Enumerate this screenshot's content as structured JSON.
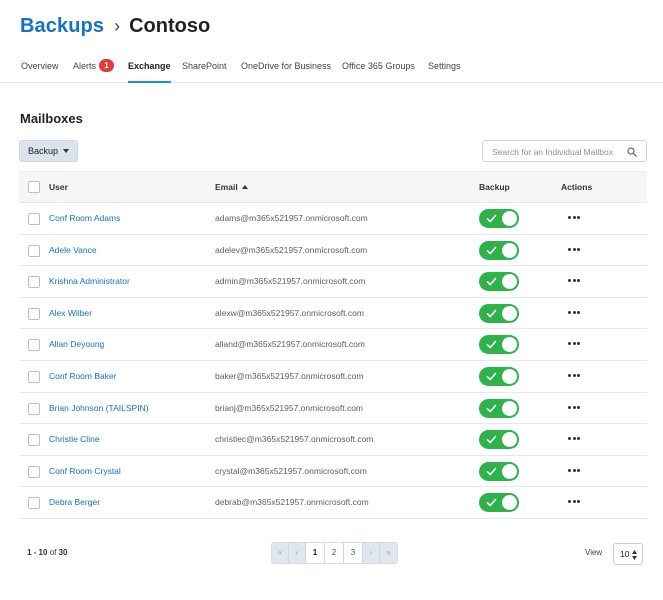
{
  "breadcrumb": {
    "root": "Backups",
    "separator": "›",
    "current": "Contoso"
  },
  "tabs": [
    {
      "label": "Overview",
      "badge": null,
      "active": false
    },
    {
      "label": "Alerts",
      "badge": "1",
      "active": false
    },
    {
      "label": "Exchange",
      "badge": null,
      "active": true
    },
    {
      "label": "SharePoint",
      "badge": null,
      "active": false
    },
    {
      "label": "OneDrive for Business",
      "badge": null,
      "active": false
    },
    {
      "label": "Office 365 Groups",
      "badge": null,
      "active": false
    },
    {
      "label": "Settings",
      "badge": null,
      "active": false
    }
  ],
  "section": {
    "title": "Mailboxes"
  },
  "toolbar": {
    "backup_label": "Backup",
    "search_placeholder": "Search for an Individual Mailbox"
  },
  "table": {
    "columns": {
      "user": "User",
      "email": "Email",
      "backup": "Backup",
      "actions": "Actions"
    },
    "rows": [
      {
        "user": "Conf Room Adams",
        "email": "adams@m365x521957.onmicrosoft.com",
        "backup": true
      },
      {
        "user": "Adele Vance",
        "email": "adelev@m365x521957.onmicrosoft.com",
        "backup": true
      },
      {
        "user": "Krishna Administrator",
        "email": "admin@m365x521957.onmicrosoft.com",
        "backup": true
      },
      {
        "user": "Alex Wilber",
        "email": "alexw@m365x521957.onmicrosoft.com",
        "backup": true
      },
      {
        "user": "Allan Deyoung",
        "email": "alland@m365x521957.onmicrosoft.com",
        "backup": true
      },
      {
        "user": "Conf Room Baker",
        "email": "baker@m365x521957.onmicrosoft.com",
        "backup": true
      },
      {
        "user": "Brian Johnson (TAILSPIN)",
        "email": "brianj@m365x521957.onmicrosoft.com",
        "backup": true
      },
      {
        "user": "Christie Cline",
        "email": "christiec@m365x521957.onmicrosoft.com",
        "backup": true
      },
      {
        "user": "Conf Room Crystal",
        "email": "crystal@m365x521957.onmicrosoft.com",
        "backup": true
      },
      {
        "user": "Debra Berger",
        "email": "debrab@m365x521957.onmicrosoft.com",
        "backup": true
      }
    ]
  },
  "footer": {
    "range": "1 - 10",
    "of_text": "of",
    "total": "30",
    "pages": [
      "1",
      "2",
      "3"
    ],
    "current_page": "1",
    "view_label": "View",
    "page_size": "10"
  },
  "colors": {
    "accent": "#1b8fe0",
    "link": "#1a6fc4",
    "toggle_on": "#2fb24a",
    "badge": "#e23b3b"
  }
}
